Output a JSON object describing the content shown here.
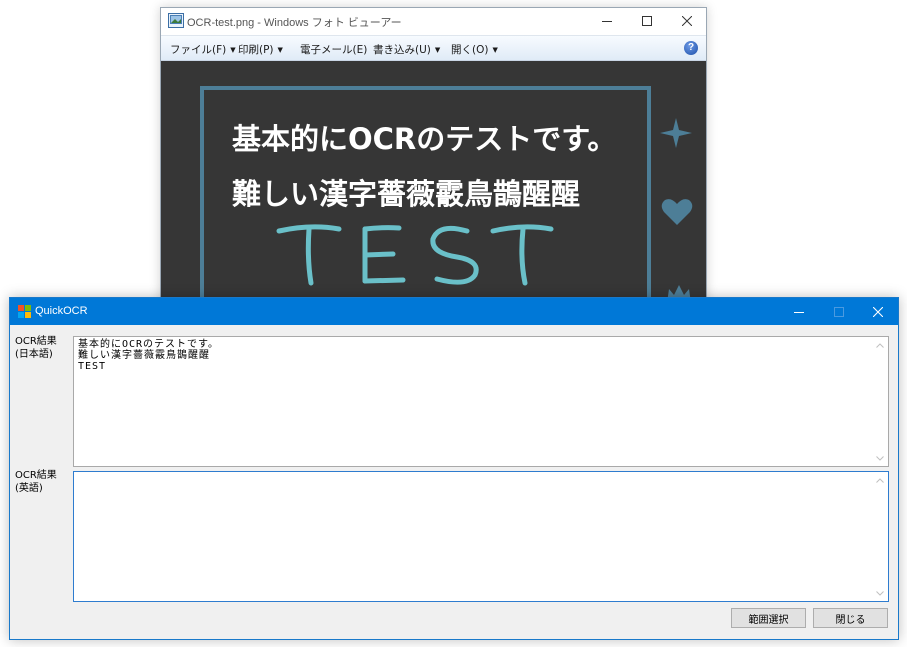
{
  "viewer": {
    "title": "OCR-test.png - Windows フォト ビューアー",
    "menu": [
      {
        "label": "ファイル(F)",
        "has_arrow": true
      },
      {
        "label": "印刷(P)",
        "has_arrow": true
      },
      {
        "label": "電子メール(E)",
        "has_arrow": false
      },
      {
        "label": "書き込み(U)",
        "has_arrow": true
      },
      {
        "label": "開く(O)",
        "has_arrow": true
      }
    ],
    "help_icon": "help-icon",
    "photo": {
      "line1": "基本的にOCRのテストです。",
      "line2": "難しい漢字薔薇霰鳥鵲醒醒",
      "handwritten": "TEST"
    }
  },
  "quickocr": {
    "title": "QuickOCR",
    "jp_label_line1": "OCR結果",
    "jp_label_line2": "(日本語)",
    "jp_text": "基本的にOCRのテストです。\n難しい漢字薔薇霰鳥鵲醒醒\nTEST",
    "en_label_line1": "OCR結果",
    "en_label_line2": "(英語)",
    "en_text": "",
    "select_range_button": "範囲選択",
    "close_button": "閉じる"
  },
  "colors": {
    "titlebar_active": "#0078d7",
    "photo_background": "#363636",
    "photo_frame": "#4d7e97",
    "handwriting": "#6ac0c9"
  }
}
